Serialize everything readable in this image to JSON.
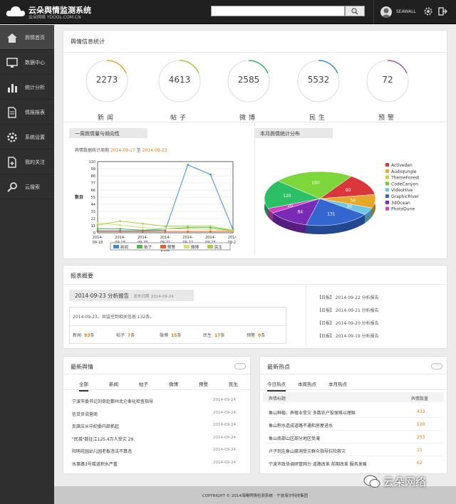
{
  "header": {
    "title": "云朵舆情监测系统",
    "subtitle": "云朵网络 YDOOL.COM.CN",
    "search_placeholder": "",
    "username": "SEAWALL"
  },
  "sidebar": {
    "items": [
      {
        "label": "舆情首页",
        "icon": "home-icon",
        "active": true
      },
      {
        "label": "数据中心",
        "icon": "monitor-icon"
      },
      {
        "label": "统计分析",
        "icon": "bar-chart-icon"
      },
      {
        "label": "情报报表",
        "icon": "document-icon"
      },
      {
        "label": "系统设置",
        "icon": "gear-icon"
      },
      {
        "label": "我的关注",
        "icon": "follow-icon"
      },
      {
        "label": "云搜索",
        "icon": "search-icon"
      }
    ]
  },
  "stats": {
    "title": "舆情信息统计",
    "items": [
      {
        "label": "新闻",
        "value": "2273",
        "color": "#f0a030"
      },
      {
        "label": "帖子",
        "value": "4613",
        "color": "#9ccc3c"
      },
      {
        "label": "微博",
        "value": "2585",
        "color": "#36b36a"
      },
      {
        "label": "民生",
        "value": "5532",
        "color": "#3a8fd6"
      },
      {
        "label": "预警",
        "value": "72",
        "color": "#9b59b6"
      }
    ]
  },
  "trend": {
    "title": "一周舆情量与倾向性",
    "period_label": "舆情数据统计周期",
    "period_from": "2014-09-17",
    "period_to_label": "至",
    "period_to": "2014-09-23"
  },
  "dist": {
    "title": "本月舆情统计分布"
  },
  "chart_data": [
    {
      "type": "line",
      "title": "",
      "xlabel": "时间",
      "ylabel": "数目",
      "x": [
        "2014-09-18",
        "2014-09-18",
        "2014-09-20",
        "2014-09-21",
        "2014-09-22",
        "2014-09-23",
        "2014-09-24"
      ],
      "yticks": [
        0,
        11,
        22,
        33,
        44,
        55,
        66,
        77,
        88,
        99,
        110
      ],
      "ylim": [
        0,
        110
      ],
      "series": [
        {
          "name": "新闻",
          "color": "#3a8fd6",
          "values": [
            3,
            3,
            3,
            4,
            105,
            90,
            5
          ]
        },
        {
          "name": "帖子",
          "color": "#4cb848",
          "values": [
            6,
            6,
            4,
            6,
            8,
            8,
            3
          ]
        },
        {
          "name": "预警",
          "color": "#e8602c",
          "values": [
            2,
            2,
            2,
            2,
            2,
            2,
            2
          ]
        },
        {
          "name": "微博",
          "color": "#dede78",
          "values": [
            15,
            12,
            8,
            6,
            6,
            5,
            3
          ]
        },
        {
          "name": "民生",
          "color": "#a8d040",
          "values": [
            12,
            18,
            14,
            10,
            10,
            10,
            4
          ]
        }
      ]
    },
    {
      "type": "pie",
      "title": "",
      "legend_position": "right",
      "slices": [
        {
          "name": "Activeden",
          "value": 90,
          "color": "#d9373b"
        },
        {
          "name": "AudioJungle",
          "value": 56,
          "color": "#e8a92a"
        },
        {
          "name": "ThemeForest",
          "value": 0,
          "color": "#c6d43a"
        },
        {
          "name": "CodeCanyon",
          "value": 0,
          "color": "#79c93a"
        },
        {
          "name": "VideoHive",
          "value": 30,
          "color": "#6ec6e6"
        },
        {
          "name": "GraphicRiver",
          "value": 131,
          "color": "#3466d0"
        },
        {
          "name": "3dOcean",
          "value": 84,
          "color": "#7a2bb6"
        },
        {
          "name": "PhotoDune",
          "value": 20,
          "color": "#d63fc4"
        },
        {
          "name": "",
          "value": 120,
          "color": "#2cc066"
        },
        {
          "name": "",
          "value": 160,
          "color": "#7dd63a"
        }
      ]
    }
  ],
  "report": {
    "title": "报表概要",
    "report_name": "2014-09-23 分析报告",
    "report_date_label": "发布日期",
    "report_date": "2014-09-24",
    "summary": "2014-09-23，共监控到相关信息 132条。",
    "counts": [
      {
        "label": "新闻",
        "value": "93",
        "unit": "条"
      },
      {
        "label": "帖子",
        "value": "7",
        "unit": "条"
      },
      {
        "label": "微博",
        "value": "15",
        "unit": "条"
      },
      {
        "label": "民生",
        "value": "17",
        "unit": "条"
      },
      {
        "label": "预警",
        "value": "0",
        "unit": "条"
      }
    ],
    "daily": [
      "【日报】 2014-09-22 分析报告",
      "【日报】 2014-09-21 分析报告",
      "【日报】 2014-09-20 分析报告",
      "【日报】 2014-09-19 分析报告"
    ]
  },
  "latest": {
    "title": "最新舆情",
    "more": "···",
    "tabs": [
      "全部",
      "新闻",
      "帖子",
      "微博",
      "预警",
      "民生"
    ],
    "rows": [
      {
        "text": "宁波市委书记刘奇赴鄞州北仑奉化检查指导",
        "date": "2014-09-24"
      },
      {
        "text": "信贷员说营商",
        "date": "2014-09-24"
      },
      {
        "text": "反腐应从中纪委内部抓起",
        "date": "2014-09-24"
      },
      {
        "text": "\"民孤\"数征江125.4万人受灾 29.",
        "date": "2014-09-24"
      },
      {
        "text": "阳明花园幼儿园老板违法不算违",
        "date": "2014-09-24"
      },
      {
        "text": "水事路3号楼道积水严重",
        "date": "2014-09-24"
      }
    ]
  },
  "hot": {
    "title": "最新热点",
    "more": "···",
    "tabs": [
      "今日热点",
      "本周热点",
      "本月热点"
    ],
    "col_title": "舆情标题",
    "col_count": "舆情数量",
    "rows": [
      {
        "text": "象山种植、养殖业受灾 多数农户投保难以理赔",
        "count": "433"
      },
      {
        "text": "象山积水造成道路不通和房屋进水",
        "count": "520"
      },
      {
        "text": "象山南部山区部分地区受淹",
        "count": "253"
      },
      {
        "text": "卢子到左象山腐洞受灾群众指导抗险救灾",
        "count": "15"
      },
      {
        "text": "宁波市政协调研管网力 道路改革 前期改革 服务发展",
        "count": "62"
      }
    ]
  },
  "footer": {
    "text": "COPYRIGHT © 2014海曙舆情检测系统 · 宁波海尔科技集团"
  },
  "watermark": {
    "text": "云朵网络"
  }
}
